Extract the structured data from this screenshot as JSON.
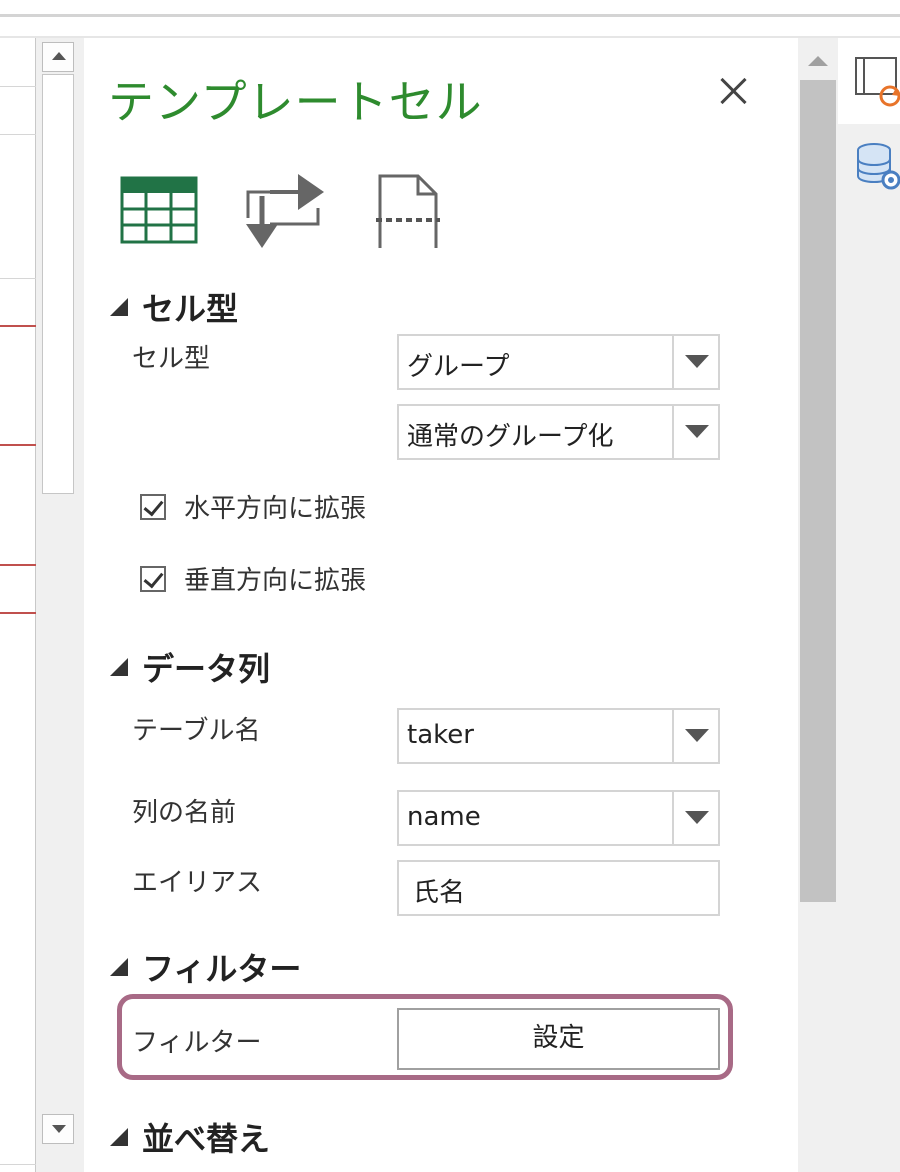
{
  "panel": {
    "title": "テンプレートセル",
    "toolbar_icons": [
      "table-grid-icon",
      "swap-arrows-icon",
      "page-break-icon"
    ]
  },
  "sections": {
    "cell_type": {
      "heading": "セル型",
      "type_label": "セル型",
      "type_value": "グループ",
      "group_mode_value": "通常のグループ化",
      "expand_horizontal_label": "水平方向に拡張",
      "expand_horizontal_checked": true,
      "expand_vertical_label": "垂直方向に拡張",
      "expand_vertical_checked": true
    },
    "data_column": {
      "heading": "データ列",
      "table_label": "テーブル名",
      "table_value": "taker",
      "column_label": "列の名前",
      "column_value": "name",
      "alias_label": "エイリアス",
      "alias_value": "氏名"
    },
    "filter": {
      "heading": "フィルター",
      "filter_label": "フィルター",
      "settings_button": "設定"
    },
    "sort": {
      "heading": "並べ替え"
    }
  },
  "colors": {
    "title": "#2e8b2e",
    "highlight_border": "#a86a86",
    "table_icon": "#217346",
    "sheet_red_line": "#c0504d",
    "accent_orange": "#e8742a",
    "db_icon": "#4a7fc1"
  },
  "right_strip_icons": [
    "template-refresh-icon",
    "database-settings-icon"
  ]
}
